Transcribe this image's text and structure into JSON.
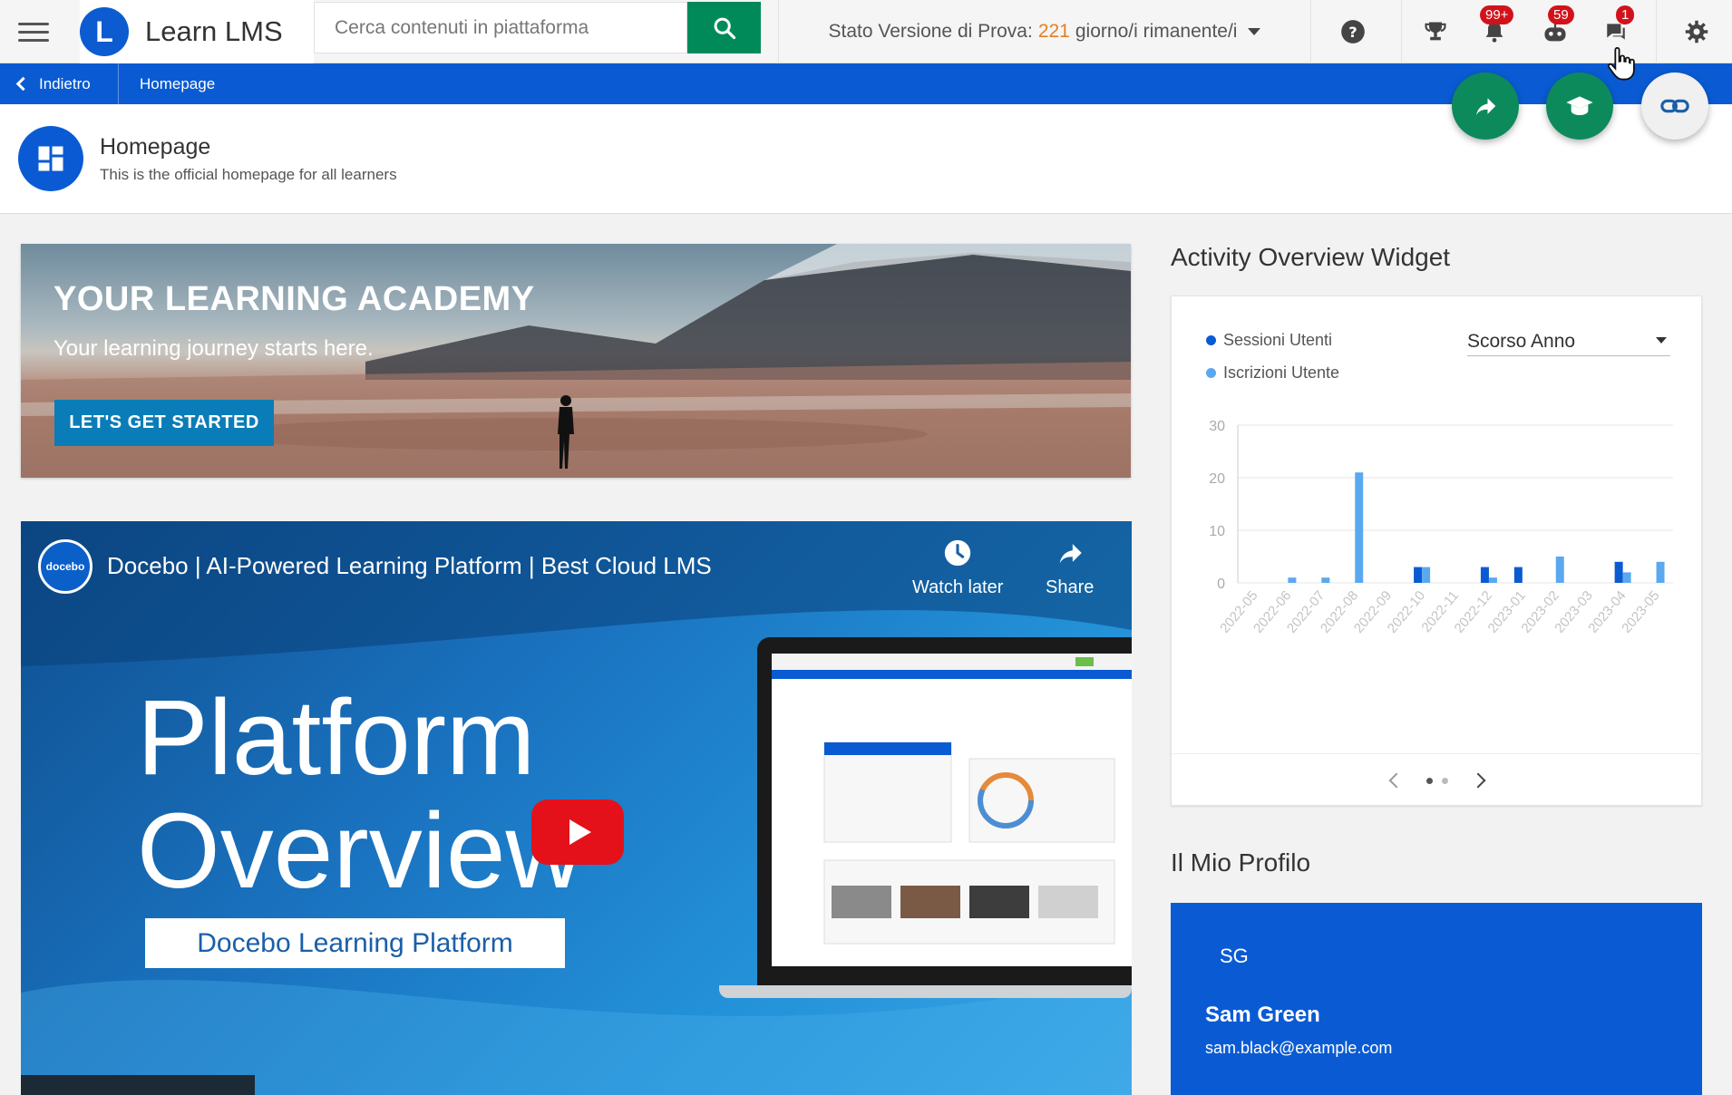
{
  "topbar": {
    "brand_name": "Learn LMS",
    "brand_logo_letter": "L",
    "search_placeholder": "Cerca contenuti in piattaforma",
    "trial_label": "Stato Versione di Prova:",
    "trial_days": "221",
    "trial_suffix": "giorno/i rimanente/i",
    "notifications_badge": "99+",
    "chat_bot_badge": "59",
    "messages_badge": "1"
  },
  "breadcrumb": {
    "back_label": "Indietro",
    "current_label": "Homepage"
  },
  "page_header": {
    "title": "Homepage",
    "subtitle": "This is the official homepage for all learners"
  },
  "hero": {
    "title": "YOUR LEARNING ACADEMY",
    "subtitle": "Your learning journey starts here.",
    "button_label": "LET'S GET STARTED"
  },
  "video": {
    "channel_label": "docebo",
    "title": "Docebo | AI-Powered Learning Platform | Best Cloud LMS",
    "watch_later_label": "Watch later",
    "share_label": "Share",
    "big_line1": "Platform",
    "big_line2": "Overview",
    "box_label": "Docebo Learning Platform"
  },
  "activity_widget": {
    "title": "Activity Overview Widget",
    "period_selected": "Scorso Anno",
    "legend_sessions": "Sessioni Utenti",
    "legend_enrollments": "Iscrizioni Utente"
  },
  "chart_data": {
    "type": "bar",
    "title": "",
    "xlabel": "",
    "ylabel": "",
    "ylim": [
      0,
      30
    ],
    "yticks": [
      0,
      10,
      20,
      30
    ],
    "grid": true,
    "legend_position": "top-left",
    "categories": [
      "2022-05",
      "2022-06",
      "2022-07",
      "2022-08",
      "2022-09",
      "2022-10",
      "2022-11",
      "2022-12",
      "2023-01",
      "2023-02",
      "2023-03",
      "2023-04",
      "2023-05"
    ],
    "series": [
      {
        "name": "Sessioni Utenti",
        "color": "#0a5bd3",
        "values": [
          0,
          0,
          0,
          0,
          0,
          3,
          0,
          3,
          3,
          0,
          0,
          4,
          0
        ]
      },
      {
        "name": "Iscrizioni Utente",
        "color": "#5aa9f0",
        "values": [
          0,
          1,
          1,
          21,
          0,
          3,
          0,
          1,
          0,
          5,
          0,
          2,
          4
        ]
      }
    ]
  },
  "profile": {
    "title": "Il Mio Profilo",
    "initials": "SG",
    "name": "Sam Green",
    "email": "sam.black@example.com"
  },
  "colors": {
    "brand_blue": "#0a5bd3",
    "search_green": "#008a5a",
    "fab_green": "#0d8a5c",
    "trial_orange": "#e67e22",
    "badge_red": "#d2121b",
    "cta_blue": "#0a7db8"
  }
}
